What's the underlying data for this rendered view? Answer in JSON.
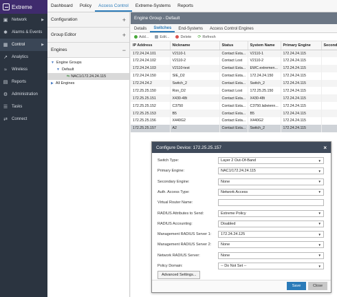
{
  "app": {
    "brand": "Extreme"
  },
  "leftnav": [
    {
      "label": "Network",
      "icon": "network-icon",
      "arrow": true
    },
    {
      "label": "Alarms & Events",
      "icon": "alarm-icon",
      "arrow": false
    },
    {
      "label": "Control",
      "icon": "control-icon",
      "arrow": true,
      "active": true
    },
    {
      "label": "Analytics",
      "icon": "analytics-icon",
      "arrow": false
    },
    {
      "label": "Wireless",
      "icon": "wireless-icon",
      "arrow": false
    },
    {
      "label": "Reports",
      "icon": "reports-icon",
      "arrow": false
    },
    {
      "label": "Administration",
      "icon": "admin-icon",
      "arrow": false
    },
    {
      "label": "Tasks",
      "icon": "tasks-icon",
      "arrow": false
    },
    {
      "label": "Connect",
      "icon": "connect-icon",
      "arrow": false
    }
  ],
  "topTabs": [
    "Dashboard",
    "Policy",
    "Access Control",
    "Extreme-Systems",
    "Reports"
  ],
  "midpanel": {
    "configuration": "Configuration",
    "groupEditor": "Group Editor",
    "engines": "Engines",
    "tree": {
      "engineGroups": "Engine Groups",
      "default": "Default",
      "nac": "NAC1/172.24.24.115",
      "allEngines": "All Engines"
    }
  },
  "content": {
    "title": "Engine Group - Default",
    "subTabs": [
      "Details",
      "Switches",
      "End-Systems",
      "Access Control Engines"
    ],
    "toolbar": {
      "add": "Add...",
      "edit": "Edit...",
      "delete": "Delete",
      "refresh": "Refresh"
    },
    "columns": [
      "IP Address",
      "Nickname",
      "Status",
      "System Name",
      "Primary Engine",
      "Second"
    ],
    "rows": [
      [
        "172.24.24.101",
        "V2110-1",
        "Contact Esta...",
        "V2110-1",
        "172.24.24.115",
        ""
      ],
      [
        "172.24.24.102",
        "V2110-2",
        "Contact Lost",
        "V2110-2",
        "172.24.24.115",
        ""
      ],
      [
        "172.24.24.103",
        "V2110-test",
        "Contact Esta...",
        "EWC.extremen...",
        "172.24.24.115",
        ""
      ],
      [
        "172.24.24.150",
        "SIE_D2",
        "Contact Esta...",
        "172.24.24.150",
        "172.24.24.115",
        ""
      ],
      [
        "172.24.24.2",
        "Switch_2",
        "Contact Esta...",
        "Switch_2",
        "172.24.24.115",
        ""
      ],
      [
        "172.25.25.150",
        "Ron_D2",
        "Contact Lost",
        "172.25.25.150",
        "172.24.24.115",
        ""
      ],
      [
        "172.25.25.151",
        "X430-48t",
        "Contact Esta...",
        "X430-48t",
        "172.24.24.115",
        ""
      ],
      [
        "172.25.25.152",
        "C3750",
        "Contact Esta...",
        "C3750.labvienn...",
        "172.24.24.115",
        ""
      ],
      [
        "172.25.25.153",
        "B5",
        "Contact Esta...",
        "B5",
        "172.24.24.115",
        ""
      ],
      [
        "172.25.25.156",
        "X440G2",
        "Contact Esta...",
        "X440G2",
        "172.24.24.115",
        ""
      ],
      [
        "172.25.25.157",
        "A2",
        "Contact Esta...",
        "Switch_2",
        "172.24.24.115",
        ""
      ]
    ],
    "selectedRow": 10
  },
  "modal": {
    "title": "Configure Device: 172.25.25.157",
    "fields": [
      {
        "label": "Switch Type:",
        "value": "Layer 2 Out-Of-Band",
        "select": true
      },
      {
        "label": "Primary Engine:",
        "value": "NAC1/172.24.24.115",
        "select": true
      },
      {
        "label": "Secondary Engine:",
        "value": "None",
        "select": true
      },
      {
        "label": "Auth. Access Type:",
        "value": "Network Access",
        "select": true
      },
      {
        "label": "Virtual Router Name:",
        "value": "",
        "select": false
      },
      {
        "label": "RADIUS Attributes to Send:",
        "value": "Extreme Policy",
        "select": true
      },
      {
        "label": "RADIUS Accounting:",
        "value": "Disabled",
        "select": true
      },
      {
        "label": "Management RADIUS Server 1:",
        "value": "172.24.24.125",
        "select": true
      },
      {
        "label": "Management RADIUS Server 2:",
        "value": "None",
        "select": true
      },
      {
        "label": "Network RADIUS Server:",
        "value": "None",
        "select": true
      },
      {
        "label": "Policy Domain:",
        "value": "-- Do Not Set --",
        "select": true
      }
    ],
    "advanced": "Advanced Settings...",
    "save": "Save",
    "close": "Close"
  },
  "colors": {
    "accent": "#2b7bb9",
    "nav": "#2b3440",
    "brand": "#3f2b6d"
  }
}
